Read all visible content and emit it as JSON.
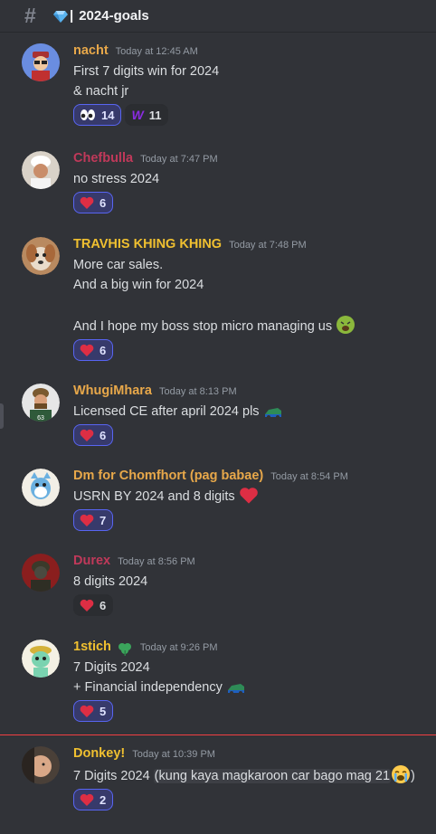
{
  "channel": {
    "name": "2024-goals",
    "separator": "|"
  },
  "messages": [
    {
      "author": "nacht",
      "color": "#e8a84a",
      "time": "Today at 12:45 AM",
      "lines": [
        "First 7 digits win for 2024",
        "& nacht jr"
      ],
      "reactions": [
        {
          "emoji": "eyes-emoji",
          "count": "14",
          "me": true
        },
        {
          "emoji": "w-emoji",
          "label": "W",
          "count": "11",
          "me": false
        }
      ]
    },
    {
      "author": "Chefbulla",
      "color": "#c0395a",
      "time": "Today at 7:47 PM",
      "lines": [
        "no stress 2024"
      ],
      "reactions": [
        {
          "emoji": "heart-emoji",
          "count": "6",
          "me": true
        }
      ]
    },
    {
      "author": "TRAVHIS KHING KHING",
      "color": "#f0c030",
      "time": "Today at 7:48 PM",
      "lines": [
        "More car sales.",
        "And a big win for 2024",
        "",
        "And I hope my boss stop micro managing us"
      ],
      "reactions": [
        {
          "emoji": "heart-emoji",
          "count": "6",
          "me": true
        }
      ]
    },
    {
      "author": "WhugiMhara",
      "color": "#e8a84a",
      "time": "Today at 8:13 PM",
      "lines": [
        "Licensed CE after april 2024 pls"
      ],
      "reactions": [
        {
          "emoji": "heart-emoji",
          "count": "6",
          "me": true
        }
      ]
    },
    {
      "author": "Dm for Chomfhort (pag babae)",
      "color": "#e8a84a",
      "time": "Today at 8:54 PM",
      "lines": [
        "USRN BY 2024 and 8 digits"
      ],
      "reactions": [
        {
          "emoji": "heart-emoji",
          "count": "7",
          "me": true
        }
      ]
    },
    {
      "author": "Durex",
      "color": "#c0395a",
      "time": "Today at 8:56 PM",
      "lines": [
        "8 digits 2024"
      ],
      "reactions": [
        {
          "emoji": "heart-emoji",
          "count": "6",
          "me": false
        }
      ]
    },
    {
      "author": "1stich",
      "color": "#f0c030",
      "time": "Today at 9:26 PM",
      "lines": [
        "7 Digits 2024",
        "+ Financial independency"
      ],
      "reactions": [
        {
          "emoji": "heart-emoji",
          "count": "5",
          "me": true
        }
      ]
    },
    {
      "author": "Donkey!",
      "color": "#f0c030",
      "time": "Today at 10:39 PM",
      "lines": [
        "7 Digits 2024 ",
        "(kung kaya magkaroon car bago mag 21",
        ")"
      ],
      "reactions": [
        {
          "emoji": "heart-emoji",
          "count": "2",
          "me": true
        }
      ]
    }
  ]
}
